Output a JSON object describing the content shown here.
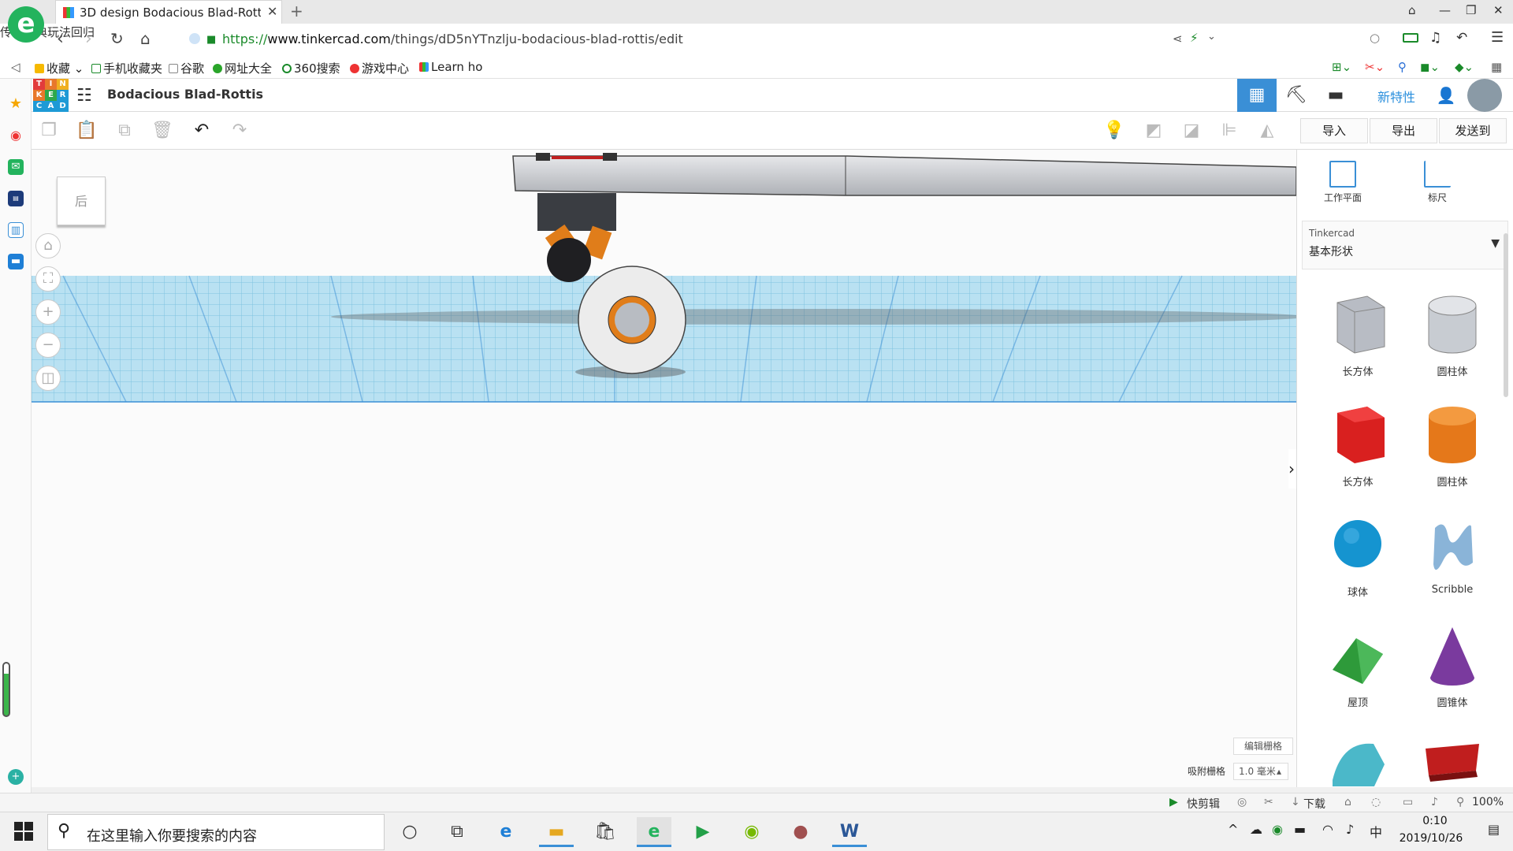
{
  "browser": {
    "tab_title": "3D design Bodacious Blad-Rotti",
    "url_scheme": "https://",
    "url_domain": "www.tinkercad.com",
    "url_path": "/things/dD5nYTnzlju-bodacious-blad-rottis/edit",
    "search_hint": "传奇经典玩法回归",
    "bookmarks": [
      "收藏",
      "手机收藏夹",
      "谷歌",
      "网址大全",
      "360搜索",
      "游戏中心",
      "Learn ho"
    ]
  },
  "header": {
    "title": "Bodacious Blad-Rottis",
    "new_features": "新特性",
    "logo_letters": [
      "T",
      "I",
      "N",
      "K",
      "E",
      "R",
      "C",
      "A",
      "D"
    ]
  },
  "toolbar": {
    "import": "导入",
    "export": "导出",
    "send_to": "发送到"
  },
  "workplane": {
    "viewcube_face": "后",
    "edit_grid": "编辑栅格",
    "snap_label": "吸附栅格",
    "snap_value": "1.0 毫米"
  },
  "panel": {
    "workplane_tool": "工作平面",
    "ruler_tool": "标尺",
    "library_source": "Tinkercad",
    "library_name": "基本形状",
    "shapes": [
      {
        "label": "长方体",
        "color": "#b8bcc4"
      },
      {
        "label": "圆柱体",
        "color": "#c8ccd2"
      },
      {
        "label": "长方体",
        "color": "#d9201f"
      },
      {
        "label": "圆柱体",
        "color": "#e5781a"
      },
      {
        "label": "球体",
        "color": "#1594d0"
      },
      {
        "label": "Scribble",
        "color": "#8ab4d8"
      },
      {
        "label": "屋顶",
        "color": "#2e9a3a"
      },
      {
        "label": "圆锥体",
        "color": "#7a3a9e"
      }
    ]
  },
  "status": {
    "clip": "快剪辑",
    "download": "下载",
    "zoom": "100%"
  },
  "taskbar": {
    "search_placeholder": "在这里输入你要搜索的内容",
    "ime": "中",
    "time": "0:10",
    "date": "2019/10/26"
  }
}
